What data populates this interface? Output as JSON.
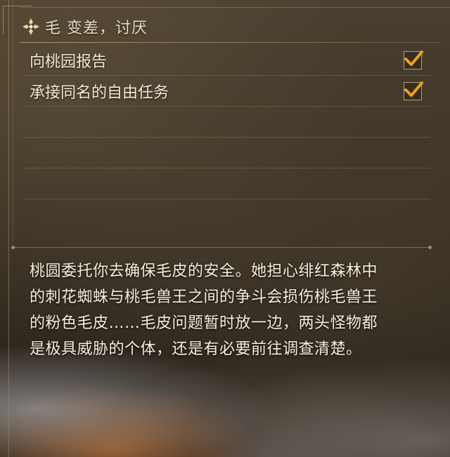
{
  "quest": {
    "title": "毛 变差，讨厌",
    "icon": "quest-diamond-icon"
  },
  "objectives": [
    {
      "label": "向桃园报告",
      "completed": true
    },
    {
      "label": "承接同名的自由任务",
      "completed": true
    }
  ],
  "description": "桃圆委托你去确保毛皮的安全。她担心绯红森林中的刺花蜘蛛与桃毛兽王之间的争斗会损伤桃毛兽王的粉色毛皮……毛皮问题暂时放一边，两头怪物都是极具威胁的个体，还是有必要前往调查清楚。",
  "colors": {
    "check": "#f0a020",
    "text": "#f2ead8",
    "rule": "#c8af82"
  }
}
